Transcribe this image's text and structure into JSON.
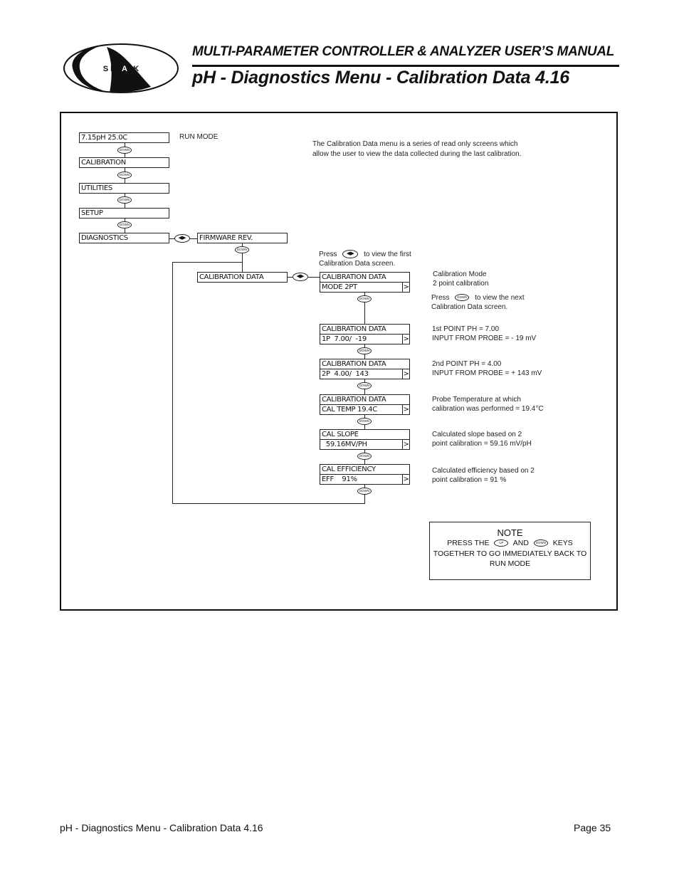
{
  "header": {
    "logo_text": "S H A R K",
    "manual_title": "MULTI-PARAMETER CONTROLLER & ANALYZER USER’S MANUAL",
    "page_title": "pH - Diagnostics Menu - Calibration Data 4.16"
  },
  "diagram": {
    "main_menu": [
      {
        "label": "7.15pH   25.0C",
        "note": "RUN MODE"
      },
      {
        "label": "CALIBRATION"
      },
      {
        "label": "UTILITIES"
      },
      {
        "label": "SETUP"
      },
      {
        "label": "DIAGNOSTICS"
      }
    ],
    "diagnostics_submenu": [
      {
        "label": "FIRMWARE REV."
      },
      {
        "label": "CALIBRATION DATA"
      }
    ],
    "intro_text_line1": "The Calibration Data menu is a series of read only screens which",
    "intro_text_line2": "allow the user to view the data collected during the last calibration.",
    "press_lr_hint": {
      "prefix": "Press",
      "suffix": "to view the first",
      "line2": "Calibration Data screen."
    },
    "press_down_hint": {
      "prefix": "Press",
      "suffix": "to view the next",
      "line2": "Calibration Data screen."
    },
    "screens": [
      {
        "top": "CALIBRATION DATA",
        "bottom": "MODE 2PT",
        "desc1": "Calibration Mode",
        "desc2": "2 point calibration"
      },
      {
        "top": "CALIBRATION DATA",
        "bottom": "1P  7.00/  -19",
        "desc1": "1st POINT   PH = 7.00",
        "desc2": "INPUT FROM PROBE = - 19 mV"
      },
      {
        "top": "CALIBRATION DATA",
        "bottom": "2P  4.00/  143",
        "desc1": "2nd POINT   PH = 4.00",
        "desc2": "INPUT FROM PROBE = + 143 mV"
      },
      {
        "top": "CALIBRATION DATA",
        "bottom": "CAL TEMP 19.4C",
        "desc1": "Probe Temperature at which",
        "desc2": "calibration was performed = 19.4°C"
      },
      {
        "top": "CAL SLOPE",
        "bottom": "  59.16MV/PH",
        "desc1": "Calculated slope based on 2",
        "desc2": "point calibration = 59.16 mV/pH"
      },
      {
        "top": "CAL EFFICIENCY",
        "bottom": "EFF    91%",
        "desc1": "Calculated efficiency based on 2",
        "desc2": "point calibration = 91 %"
      }
    ],
    "screen_arrow": ">",
    "keys": {
      "down": "DOWN",
      "up": "UP",
      "left_right": "◀▶"
    },
    "note": {
      "title": "NOTE",
      "line1_prefix": "PRESS THE",
      "line1_mid": "AND",
      "line1_suffix": "KEYS",
      "line2": "TOGETHER TO GO IMMEDIATELY BACK TO",
      "line3": "RUN MODE"
    }
  },
  "footer": {
    "left": "pH - Diagnostics Menu - Calibration Data 4.16",
    "right": "Page 35"
  }
}
